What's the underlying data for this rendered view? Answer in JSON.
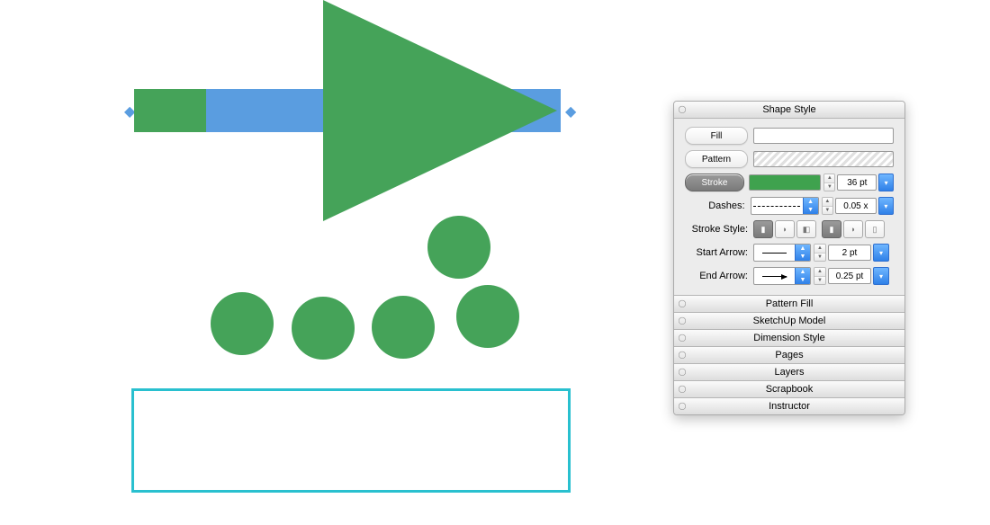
{
  "panel_title": "Shape Style",
  "fill": {
    "label": "Fill"
  },
  "pattern": {
    "label": "Pattern"
  },
  "stroke": {
    "label": "Stroke",
    "value": "36 pt"
  },
  "dashes": {
    "label": "Dashes:",
    "value": "0.05 x"
  },
  "strokeStyle": {
    "label": "Stroke Style:"
  },
  "startArrow": {
    "label": "Start Arrow:",
    "value": "2 pt"
  },
  "endArrow": {
    "label": "End Arrow:",
    "value": "0.25 pt"
  },
  "sections": {
    "patternFill": "Pattern Fill",
    "sketchup": "SketchUp Model",
    "dimension": "Dimension Style",
    "pages": "Pages",
    "layers": "Layers",
    "scrapbook": "Scrapbook",
    "instructor": "Instructor"
  },
  "colors": {
    "green": "#45a359",
    "blue": "#5a9de0",
    "cyan": "#29c0cf"
  }
}
